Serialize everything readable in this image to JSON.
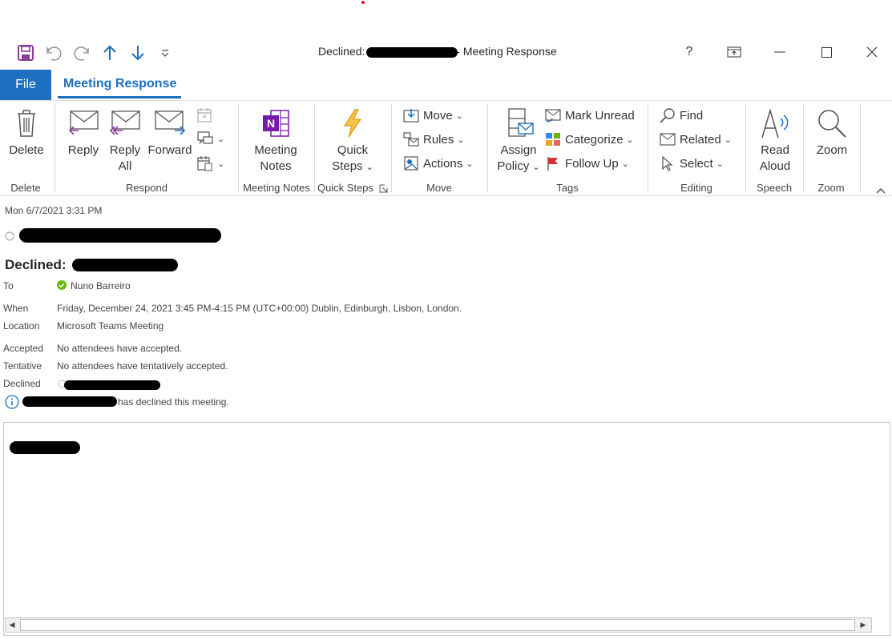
{
  "window": {
    "title_prefix": "Declined:",
    "title_suffix": "-  Meeting Response",
    "help": "?"
  },
  "tabs": {
    "file": "File",
    "active": "Meeting Response"
  },
  "ribbon": {
    "delete": {
      "button": "Delete",
      "group": "Delete"
    },
    "respond": {
      "reply": "Reply",
      "reply_all_1": "Reply",
      "reply_all_2": "All",
      "forward": "Forward",
      "group": "Respond"
    },
    "meeting_notes": {
      "line1": "Meeting",
      "line2": "Notes",
      "group": "Meeting Notes"
    },
    "quick_steps": {
      "line1": "Quick",
      "line2": "Steps",
      "group": "Quick Steps"
    },
    "move": {
      "move": "Move",
      "rules": "Rules",
      "actions": "Actions",
      "group": "Move"
    },
    "tags": {
      "assign_1": "Assign",
      "assign_2": "Policy",
      "mark_unread": "Mark Unread",
      "categorize": "Categorize",
      "follow_up": "Follow Up",
      "group": "Tags"
    },
    "editing": {
      "find": "Find",
      "related": "Related",
      "select": "Select",
      "group": "Editing"
    },
    "speech": {
      "line1": "Read",
      "line2": "Aloud",
      "group": "Speech"
    },
    "zoom": {
      "button": "Zoom",
      "group": "Zoom"
    }
  },
  "message": {
    "date": "Mon 6/7/2021 3:31 PM",
    "subject_prefix": "Declined:",
    "to_label": "To",
    "to_value": "Nuno Barreiro",
    "when_label": "When",
    "when_value": "Friday, December 24, 2021 3:45 PM-4:15 PM (UTC+00:00) Dublin, Edinburgh, Lisbon, London.",
    "location_label": "Location",
    "location_value": "Microsoft Teams Meeting",
    "accepted_label": "Accepted",
    "accepted_value": "No attendees have accepted.",
    "tentative_label": "Tentative",
    "tentative_value": "No attendees have tentatively accepted.",
    "declined_label": "Declined",
    "info_text": "has declined this meeting."
  },
  "colors": {
    "accent": "#1d6fbf",
    "onenote": "#7719aa",
    "flash": "#f3a41b",
    "flag": "#d13438",
    "presence": "#6bb700"
  }
}
